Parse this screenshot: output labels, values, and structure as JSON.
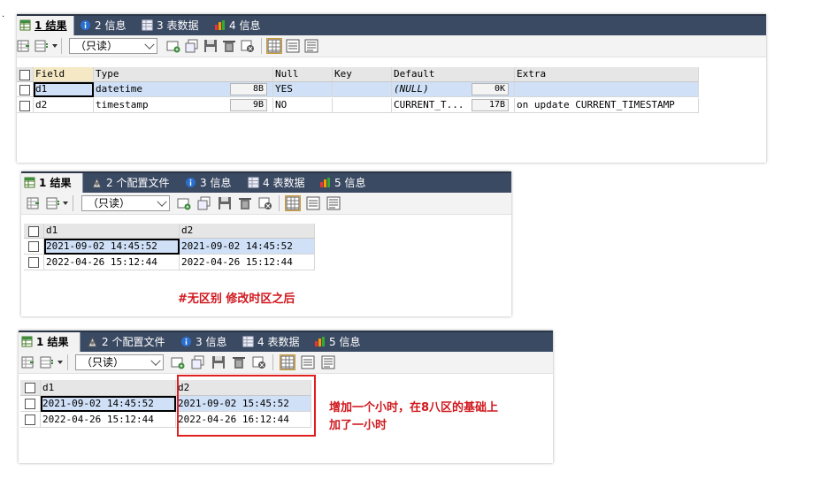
{
  "dot": "·",
  "panel1": {
    "tabs": [
      "1 结果",
      "2 信息",
      "3 表数据",
      "4 信息"
    ],
    "readonly": "（只读）",
    "headers": [
      "Field",
      "Type",
      "Null",
      "Key",
      "Default",
      "Extra"
    ],
    "rows": [
      {
        "field": "d1",
        "type": "datetime",
        "type_len": "8B",
        "null": "YES",
        "key": "",
        "default": "(NULL)",
        "default_len": "0K",
        "extra": ""
      },
      {
        "field": "d2",
        "type": "timestamp",
        "type_len": "9B",
        "null": "NO",
        "key": "",
        "default": "CURRENT_T...",
        "default_len": "17B",
        "extra": "on update CURRENT_TIMESTAMP"
      }
    ]
  },
  "panel2": {
    "tabs": [
      "1 结果",
      "2 个配置文件",
      "3 信息",
      "4 表数据",
      "5 信息"
    ],
    "readonly": "（只读）",
    "headers": [
      "d1",
      "d2"
    ],
    "rows": [
      [
        "2021-09-02 14:45:52",
        "2021-09-02 14:45:52"
      ],
      [
        "2022-04-26 15:12:44",
        "2022-04-26 15:12:44"
      ]
    ],
    "note": "#无区别 修改时区之后"
  },
  "panel3": {
    "tabs": [
      "1 结果",
      "2 个配置文件",
      "3 信息",
      "4 表数据",
      "5 信息"
    ],
    "readonly": "（只读）",
    "headers": [
      "d1",
      "d2"
    ],
    "rows": [
      [
        "2021-09-02 14:45:52",
        "2021-09-02 15:45:52"
      ],
      [
        "2022-04-26 15:12:44",
        "2022-04-26 16:12:44"
      ]
    ],
    "note_line1": "增加一个小时，在8八区的基础上",
    "note_line2": "加了一小时"
  },
  "colors": {
    "tabbar": "#3b4a63",
    "selected_row": "#cfe0f7",
    "note": "#d0181e",
    "highlight_box": "#e02020"
  }
}
